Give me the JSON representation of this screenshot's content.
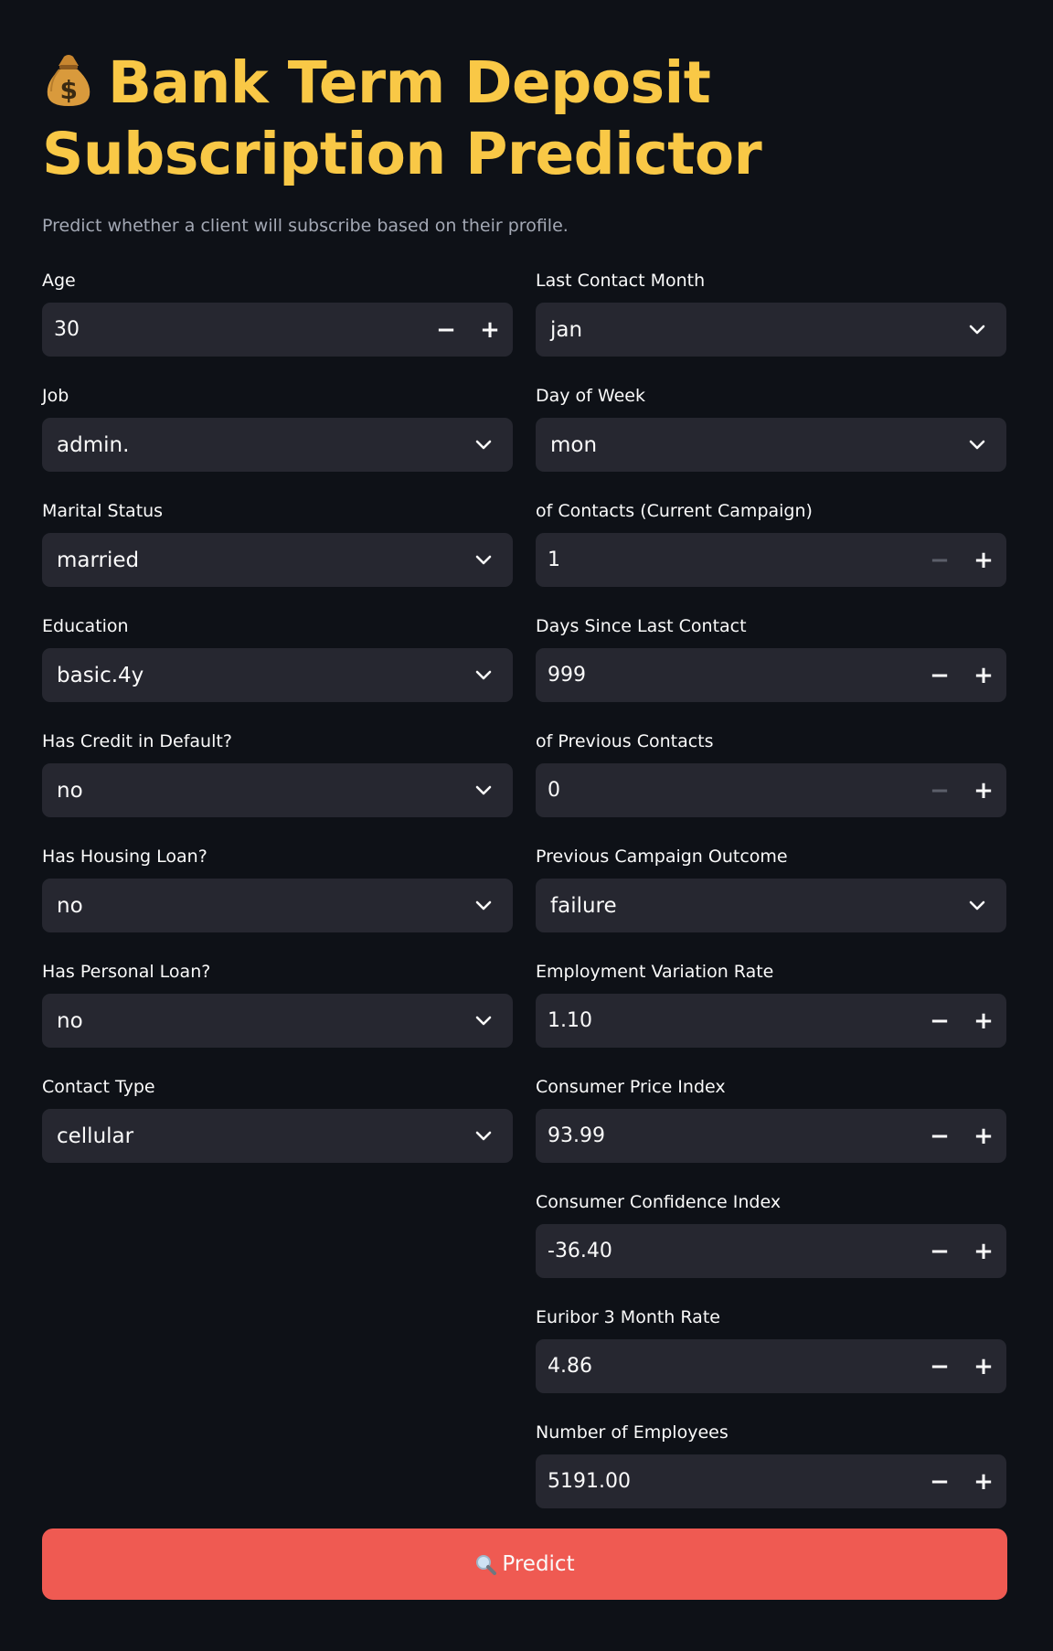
{
  "header": {
    "title": "Bank Term Deposit Subscription Predictor",
    "subtitle": "Predict whether a client will subscribe based on their profile."
  },
  "left_fields": [
    {
      "label": "Age",
      "type": "number",
      "value": "30"
    },
    {
      "label": "Job",
      "type": "select",
      "value": "admin."
    },
    {
      "label": "Marital Status",
      "type": "select",
      "value": "married"
    },
    {
      "label": "Education",
      "type": "select",
      "value": "basic.4y"
    },
    {
      "label": "Has Credit in Default?",
      "type": "select",
      "value": "no"
    },
    {
      "label": "Has Housing Loan?",
      "type": "select",
      "value": "no"
    },
    {
      "label": "Has Personal Loan?",
      "type": "select",
      "value": "no"
    },
    {
      "label": "Contact Type",
      "type": "select",
      "value": "cellular"
    }
  ],
  "right_fields": [
    {
      "label": "Last Contact Month",
      "type": "select",
      "value": "jan"
    },
    {
      "label": "Day of Week",
      "type": "select",
      "value": "mon"
    },
    {
      "label": "of Contacts (Current Campaign)",
      "type": "number",
      "value": "1"
    },
    {
      "label": "Days Since Last Contact",
      "type": "number",
      "value": "999"
    },
    {
      "label": "of Previous Contacts",
      "type": "number",
      "value": "0"
    },
    {
      "label": "Previous Campaign Outcome",
      "type": "select",
      "value": "failure"
    },
    {
      "label": "Employment Variation Rate",
      "type": "number",
      "value": "1.10"
    },
    {
      "label": "Consumer Price Index",
      "type": "number",
      "value": "93.99"
    },
    {
      "label": "Consumer Confidence Index",
      "type": "number",
      "value": "-36.40"
    },
    {
      "label": "Euribor 3 Month Rate",
      "type": "number",
      "value": "4.86"
    },
    {
      "label": "Number of Employees",
      "type": "number",
      "value": "5191.00"
    }
  ],
  "stepper": {
    "minus": "−",
    "plus": "+"
  },
  "predict_button": {
    "label": "Predict"
  },
  "colors": {
    "background": "#0e1117",
    "title": "#f9c846",
    "input_bg": "#262730",
    "button": "#ef5a52"
  }
}
